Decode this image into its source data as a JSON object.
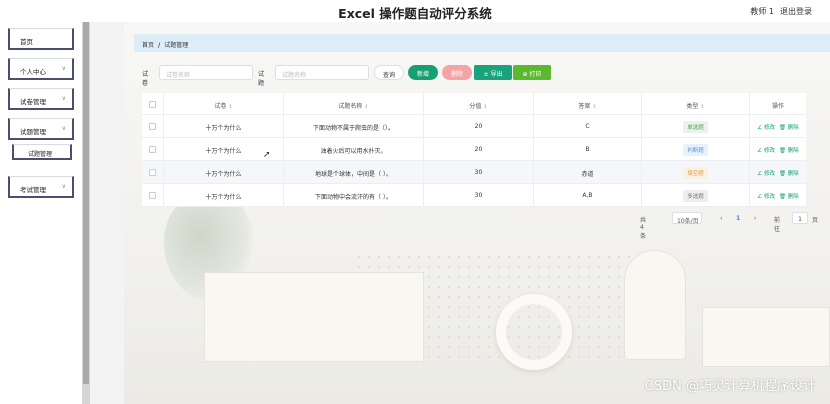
{
  "header": {
    "title": "Excel 操作题自动评分系统",
    "user": "教师 1",
    "logout": "退出登录"
  },
  "sidebar": {
    "items": [
      {
        "label": "首页",
        "has_chevron": false
      },
      {
        "label": "个人中心",
        "has_chevron": true
      },
      {
        "label": "试卷管理",
        "has_chevron": true
      },
      {
        "label": "试题管理",
        "has_chevron": true
      },
      {
        "label": "考试管理",
        "has_chevron": true
      }
    ],
    "sub_items": [
      {
        "label": "试题管理"
      }
    ],
    "chevron": "chevron-down-icon"
  },
  "breadcrumb": {
    "home": "首页",
    "separator": "/",
    "current": "试题管理"
  },
  "search": {
    "label1": "试卷",
    "placeholder1": "试卷名称",
    "label2": "试题",
    "placeholder2": "试题名称",
    "query": "查询",
    "add": "新增",
    "delete": "删除",
    "export": "± 导出",
    "print": "⊕ 打印"
  },
  "table": {
    "columns": [
      "试卷",
      "试题名称",
      "分值",
      "答案",
      "类型",
      "操作"
    ],
    "rows": [
      {
        "paper": "十万个为什么",
        "question": "下面动物不属于爬虫的是（）。",
        "score": "20",
        "answer": "C",
        "type": "单选题",
        "edit": "∠ 修改",
        "del": "🗑 删除"
      },
      {
        "paper": "十万个为什么",
        "question": "油着火后可以用水扑灭。",
        "score": "20",
        "answer": "B",
        "type": "判断题",
        "edit": "∠ 修改",
        "del": "🗑 删除"
      },
      {
        "paper": "十万个为什么",
        "question": "地球是个球体，中间是（ ）。",
        "score": "30",
        "answer": "赤道",
        "type": "填空题",
        "edit": "∠ 修改",
        "del": "🗑 删除"
      },
      {
        "paper": "十万个为什么",
        "question": "下面动物中会流汗的有（ ）。",
        "score": "30",
        "answer": "A,B",
        "type": "多选题",
        "edit": "∠ 修改",
        "del": "🗑 删除"
      }
    ]
  },
  "pagination": {
    "total": "共 4 条",
    "page_size": "10条/页",
    "current_page": "1",
    "goto_label": "前往",
    "goto_value": "1",
    "page_suffix": "页"
  },
  "watermark": "CSDN @巧灵计算机程序设计",
  "colors": {
    "primary": "#16a072",
    "crumb_bg": "#dcedf7",
    "delete": "#f4a4a4",
    "print": "#5cb82d"
  }
}
